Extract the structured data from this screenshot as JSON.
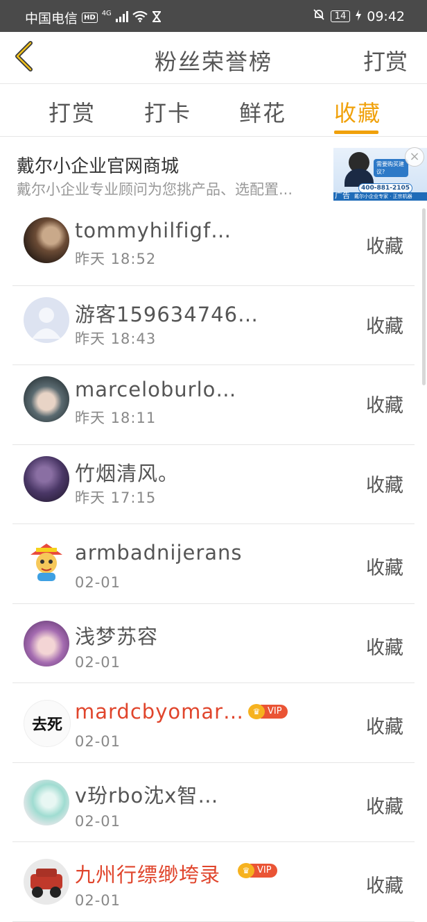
{
  "status_bar": {
    "carrier": "中国电信",
    "hd": "HD",
    "network": "4G",
    "battery": "14",
    "time": "09:42"
  },
  "nav": {
    "title": "粉丝荣誉榜",
    "right_action": "打赏"
  },
  "tabs": [
    {
      "label": "打赏",
      "active": false
    },
    {
      "label": "打卡",
      "active": false
    },
    {
      "label": "鲜花",
      "active": false
    },
    {
      "label": "收藏",
      "active": true
    }
  ],
  "ad": {
    "title": "戴尔小企业官网商城",
    "description": "戴尔小企业专业顾问为您挑产品、选配置...",
    "image_bubble": "需要购买建议?",
    "image_phone": "400-881-2105",
    "image_mark": "广告",
    "image_strip": "戴尔小企业专家 · 正宗机器"
  },
  "list": {
    "items": [
      {
        "username": "tommyhilfigf…",
        "time": "昨天  18:52",
        "action": "收藏",
        "vip": false,
        "avatar_icon": "photo-avatar"
      },
      {
        "username": "游客159634746…",
        "time": "昨天  18:43",
        "action": "收藏",
        "vip": false,
        "avatar_icon": "default-person-avatar"
      },
      {
        "username": "marceloburlo…",
        "time": "昨天  18:11",
        "action": "收藏",
        "vip": false,
        "avatar_icon": "photo-avatar"
      },
      {
        "username": "竹烟清风。",
        "time": "昨天  17:15",
        "action": "收藏",
        "vip": false,
        "avatar_icon": "photo-avatar"
      },
      {
        "username": "armbadnijerans",
        "time": "02-01",
        "action": "收藏",
        "vip": false,
        "avatar_icon": "cartoon-avatar"
      },
      {
        "username": "浅梦苏容",
        "time": "02-01",
        "action": "收藏",
        "vip": false,
        "avatar_icon": "anime-avatar"
      },
      {
        "username": "mardcbyomar…",
        "time": "02-01",
        "action": "收藏",
        "vip": true,
        "vip_label": "VIP",
        "avatar_text": "去死",
        "avatar_icon": "text-avatar"
      },
      {
        "username": "v玢rbo沈x智…",
        "time": "02-01",
        "action": "收藏",
        "vip": false,
        "avatar_icon": "anime-avatar"
      },
      {
        "username": "九州行缥缈垮录",
        "time": "02-01",
        "action": "收藏",
        "vip": true,
        "vip_label": "VIP",
        "avatar_icon": "car-avatar"
      }
    ]
  },
  "colors": {
    "accent": "#f0a10b",
    "vip_name": "#e0452c",
    "status_bar": "#4a4a4a"
  }
}
